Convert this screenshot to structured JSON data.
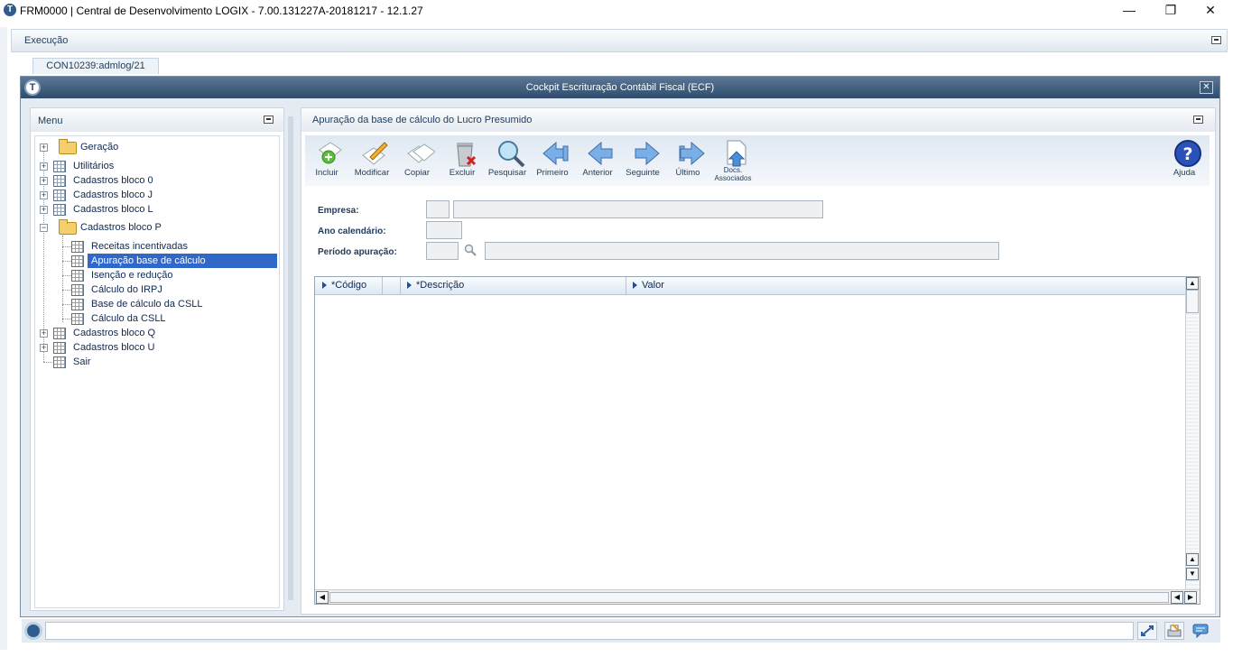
{
  "window": {
    "title": "FRM0000 | Central de Desenvolvimento LOGIX  -  7.00.131227A-20181217  -  12.1.27",
    "minimize": "—",
    "maximize": "❐",
    "close": "✕"
  },
  "exec_bar": {
    "label": "Execução"
  },
  "tabs": [
    {
      "label": "CON10239:admlog/21"
    }
  ],
  "frame": {
    "title": "Cockpit Escrituração Contábil Fiscal (ECF)",
    "close": "✕"
  },
  "menu": {
    "title": "Menu",
    "items": [
      {
        "label": "Geração"
      },
      {
        "label": "Utilitários"
      },
      {
        "label": "Cadastros bloco 0"
      },
      {
        "label": "Cadastros bloco J"
      },
      {
        "label": "Cadastros bloco L"
      },
      {
        "label": "Cadastros bloco P"
      },
      {
        "label": "Receitas incentivadas"
      },
      {
        "label": "Apuração base de cálculo"
      },
      {
        "label": "Isenção e redução"
      },
      {
        "label": "Cálculo do IRPJ"
      },
      {
        "label": "Base de cálculo da CSLL"
      },
      {
        "label": "Cálculo da CSLL"
      },
      {
        "label": "Cadastros bloco Q"
      },
      {
        "label": "Cadastros bloco U"
      },
      {
        "label": "Sair"
      }
    ]
  },
  "main": {
    "title": "Apuração da base de cálculo do Lucro Presumido",
    "toolbar": [
      {
        "label": "Incluir",
        "icon": "add-document-icon"
      },
      {
        "label": "Modificar",
        "icon": "edit-pencil-icon"
      },
      {
        "label": "Copiar",
        "icon": "copy-pages-icon"
      },
      {
        "label": "Excluir",
        "icon": "trash-icon"
      },
      {
        "label": "Pesquisar",
        "icon": "magnifier-icon"
      },
      {
        "label": "Primeiro",
        "icon": "first-arrow-icon"
      },
      {
        "label": "Anterior",
        "icon": "previous-arrow-icon"
      },
      {
        "label": "Seguinte",
        "icon": "next-arrow-icon"
      },
      {
        "label": "Último",
        "icon": "last-arrow-icon"
      },
      {
        "label": "Docs. Associados",
        "icon": "attached-docs-icon"
      },
      {
        "label": "Ajuda",
        "icon": "help-icon"
      }
    ],
    "fields": {
      "empresa_label": "Empresa:",
      "ano_label": "Ano calendário:",
      "periodo_label": "Período apuração:",
      "empresa_code": "",
      "empresa_name": "",
      "ano": "",
      "periodo_code": "",
      "periodo_desc": ""
    },
    "grid": {
      "columns": [
        "*Código",
        "*Descrição",
        "Valor"
      ],
      "rows": []
    }
  },
  "colors": {
    "header": "#2f4c6c",
    "selection": "#2f68c9",
    "accent": "#1f3a5a"
  }
}
